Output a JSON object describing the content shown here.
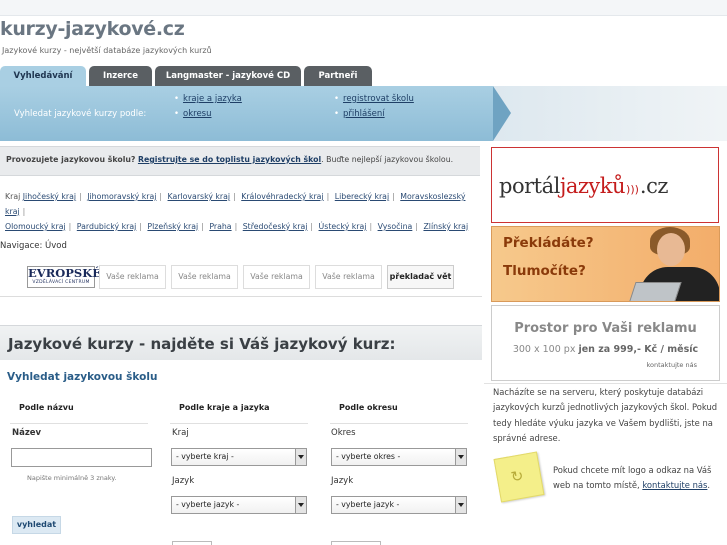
{
  "site": {
    "logo": "kurzy-jazykové.cz",
    "tagline": "Jazykové kurzy - největší databáze jazykových kurzů"
  },
  "tabs": [
    {
      "label": "Vyhledávání",
      "active": true
    },
    {
      "label": "Inzerce"
    },
    {
      "label": "Langmaster - jazykové CD"
    },
    {
      "label": "Partneři"
    }
  ],
  "search_bar": {
    "label": "Vyhledat jazykové kurzy podle:",
    "links": [
      "kraje a jazyka",
      "okresu",
      "registrovat školu",
      "přihlášení"
    ]
  },
  "promo": {
    "prefix": "Provozujete jazykovou školu?",
    "link": "Registrujte se do toplistu jazykových škol",
    "suffix": ". Buďte nejlepší jazykovou školou."
  },
  "regions": {
    "label": "Kraj",
    "items": [
      "Jihočeský kraj",
      "Jihomoravský kraj",
      "Karlovarský kraj",
      "Královéhradecký kraj",
      "Liberecký kraj",
      "Moravskoslezský kraj",
      "Olomoucký kraj",
      "Pardubický kraj",
      "Plzeňský kraj",
      "Praha",
      "Středočeský kraj",
      "Ústecký kraj",
      "Vysočina",
      "Zlínský kraj"
    ]
  },
  "navigation": "Navigace: Úvod",
  "ads": {
    "logo_title": "EVROPSKÉ",
    "logo_sub": "VZDĚLÁVACÍ CENTRUM",
    "slots": [
      "Vaše reklama",
      "Vaše reklama",
      "Vaše reklama",
      "Vaše reklama"
    ],
    "translator": "překladač vět"
  },
  "main": {
    "heading": "Jazykové kurzy - najděte si Váš jazykový kurz:",
    "subheading": "Vyhledat jazykovou školu",
    "col1": {
      "head": "Podle názvu",
      "label": "Název",
      "hint": "Napište minimálně 3 znaky.",
      "button": "vyhledat"
    },
    "col2": {
      "head": "Podle kraje a jazyka",
      "kraj_label": "Kraj",
      "kraj_value": "- vyberte kraj -",
      "jazyk_label": "Jazyk",
      "jazyk_value": "- vyberte jazyk -"
    },
    "col3": {
      "head": "Podle okresu",
      "okres_label": "Okres",
      "okres_value": "- vyberte okres -",
      "jazyk_label": "Jazyk",
      "jazyk_value": "- vyberte jazyk -"
    }
  },
  "sidebar": {
    "portal_a": "portál",
    "portal_b": "jazyků",
    "portal_c": ".cz",
    "translate_q1": "Překládáte?",
    "translate_q2": "Tlumočíte?",
    "ad_title": "Prostor pro Vaši reklamu",
    "ad_size": "300 x 100 px",
    "ad_price": "jen za 999,- Kč / měsíc",
    "ad_contact": "kontaktujte nás",
    "info": "Nacházíte se na serveru, který poskytuje databázi jazykových kurzů jednotlivých jazykových škol. Pokud tedy hledáte výuku jazyka ve Vašem bydlišti, jste na správné adrese.",
    "logo_text": "Pokud chcete mít logo a odkaz na Váš web na tomto místě,",
    "logo_link": "kontaktujte nás",
    "logo_end": "."
  },
  "colors": {
    "tab_active": "#a9cfe3",
    "tab": "#5a5f63",
    "link": "#1f3f66",
    "accent_red": "#c41c1c"
  }
}
